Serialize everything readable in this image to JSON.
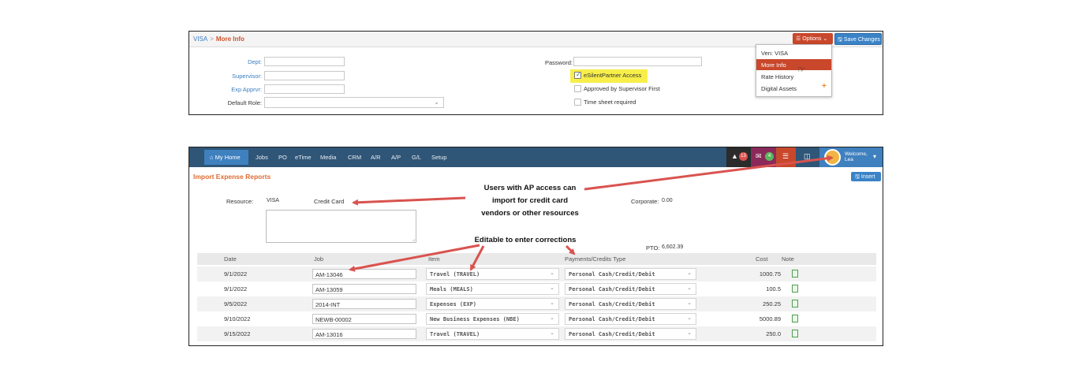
{
  "panel1": {
    "breadcrumb": {
      "link": "VISA",
      "separator": ">",
      "current": "More Info"
    },
    "options_label": "Options",
    "save_label": "Save Changes",
    "fields": {
      "dept_label": "Dept:",
      "supervisor_label": "Supervisor:",
      "exp_apprvr_label": "Exp Apprvr:",
      "default_role_label": "Default Role:",
      "password_label": "Password:"
    },
    "checkboxes": [
      {
        "label": "eSilentPartner Access",
        "checked": true
      },
      {
        "label": "Approved by Supervisor First",
        "checked": false
      },
      {
        "label": "Time sheet required",
        "checked": false
      }
    ],
    "options_menu": {
      "items": [
        "Ven: VISA",
        "More Info",
        "Rate History",
        "Digital Assets"
      ],
      "active": "More Info"
    }
  },
  "panel2": {
    "nav": [
      "My Home",
      "Jobs",
      "PO",
      "eTime",
      "Media",
      "CRM",
      "A/R",
      "A/P",
      "G/L",
      "Setup"
    ],
    "notifications": {
      "bell": "13",
      "mail": "4"
    },
    "welcome": {
      "line1": "Welcome,",
      "line2": "Lea"
    },
    "title": "Import Expense Reports",
    "insert_label": "Insert",
    "resource_label": "Resource:",
    "resource_value": "VISA",
    "resource_type": "Credit Card",
    "corporate_label": "Corporate:",
    "corporate_value": "0.00",
    "pto_label": "PTO:",
    "pto_value": "6,602.39",
    "table": {
      "headers": [
        "Date",
        "Job",
        "Item",
        "Payments/Credits Type",
        "Cost",
        "Note"
      ],
      "rows": [
        {
          "date": "9/1/2022",
          "job": "AM-13046",
          "item": "Travel (TRAVEL)",
          "type": "Personal Cash/Credit/Debit",
          "cost": "1000.75"
        },
        {
          "date": "9/1/2022",
          "job": "AM-13059",
          "item": "Meals (MEALS)",
          "type": "Personal Cash/Credit/Debit",
          "cost": "100.5"
        },
        {
          "date": "9/5/2022",
          "job": "2014-INT",
          "item": "Expenses (EXP)",
          "type": "Personal Cash/Credit/Debit",
          "cost": "250.25"
        },
        {
          "date": "9/10/2022",
          "job": "NEWB-00002",
          "item": "New Business Expenses (NBE)",
          "type": "Personal Cash/Credit/Debit",
          "cost": "5000.89"
        },
        {
          "date": "9/15/2022",
          "job": "AM-13016",
          "item": "Travel (TRAVEL)",
          "type": "Personal Cash/Credit/Debit",
          "cost": "250.0"
        }
      ]
    }
  },
  "annotations": {
    "ap_access_line1": "Users with AP access can",
    "ap_access_line2": "import for credit card",
    "ap_access_line3": "vendors or other resources",
    "editable": "Editable to enter corrections"
  },
  "colors": {
    "accent_red": "#c9472b",
    "accent_blue": "#3a83c7",
    "navbar": "#2f5577",
    "arrow": "#d9534f",
    "highlight": "#f8ee4a"
  }
}
